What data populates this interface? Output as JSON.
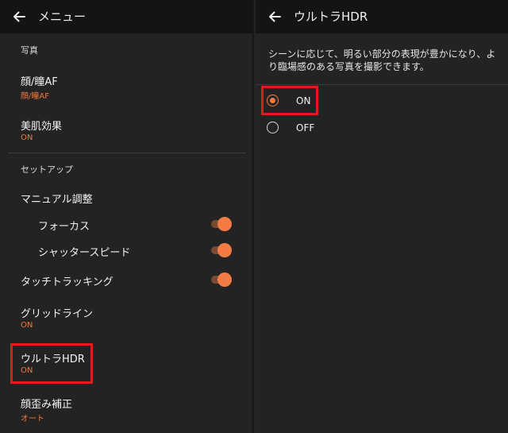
{
  "left_panel": {
    "header": {
      "title": "メニュー"
    },
    "sections": {
      "photo": {
        "label": "写真"
      },
      "setup": {
        "label": "セットアップ"
      }
    },
    "items": {
      "face_eye_af": {
        "title": "顔/瞳AF",
        "value": "顔/瞳AF"
      },
      "beauty": {
        "title": "美肌効果",
        "value": "ON"
      },
      "manual": {
        "title": "マニュアル調整"
      },
      "focus": {
        "title": "フォーカス",
        "toggle": "on"
      },
      "shutter": {
        "title": "シャッタースピード",
        "toggle": "on"
      },
      "touch_tracking": {
        "title": "タッチトラッキング",
        "toggle": "on"
      },
      "gridline": {
        "title": "グリッドライン",
        "value": "ON"
      },
      "ultra_hdr": {
        "title": "ウルトラHDR",
        "value": "ON"
      },
      "distortion": {
        "title": "顔歪み補正",
        "value": "オート"
      }
    }
  },
  "right_panel": {
    "header": {
      "title": "ウルトラHDR"
    },
    "description": "シーンに応じて、明るい部分の表現が豊かになり、より臨場感のある写真を撮影できます。",
    "options": [
      {
        "label": "ON",
        "selected": true
      },
      {
        "label": "OFF",
        "selected": false
      }
    ]
  },
  "colors": {
    "accent": "#f47b45",
    "highlight": "#e01b1b",
    "background": "#232323",
    "appbar": "#141414"
  },
  "icons": {
    "back": "arrow-left-icon"
  }
}
